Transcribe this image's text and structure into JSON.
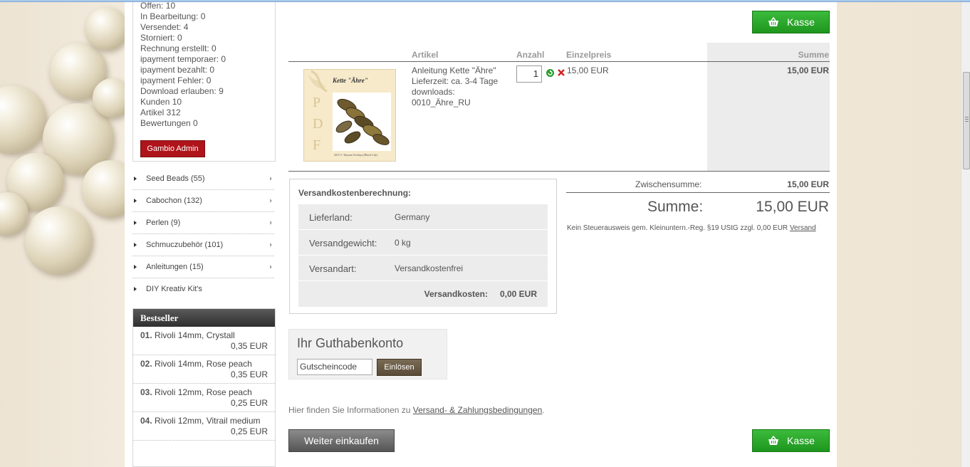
{
  "admin": {
    "stats": [
      "Offen: 10",
      "In Bearbeitung: 0",
      "Versendet: 4",
      "Storniert: 0",
      "Rechnung erstellt: 0",
      "ipayment temporaer: 0",
      "ipayment bezahlt: 0",
      "ipayment Fehler: 0",
      "Download erlauben: 9",
      "Kunden 10",
      "Artikel 312",
      "Bewertungen 0"
    ],
    "button_label": "Gambio Admin"
  },
  "categories": [
    "Seed Beads (55)",
    "Cabochon (132)",
    "Perlen (9)",
    "Schmuczubehör (101)",
    "Anleitungen (15)",
    "DIY Kreativ Kit's"
  ],
  "bestseller": {
    "title": "Bestseller",
    "items": [
      {
        "num": "01.",
        "name": "Rivoli 14mm, Crystall",
        "price": "0,35 EUR"
      },
      {
        "num": "02.",
        "name": "Rivoli 14mm, Rose peach",
        "price": "0,35 EUR"
      },
      {
        "num": "03.",
        "name": "Rivoli 12mm, Rose peach",
        "price": "0,25 EUR"
      },
      {
        "num": "04.",
        "name": "Rivoli 12mm, Vitrail medium",
        "price": "0,25 EUR"
      }
    ]
  },
  "cart": {
    "checkout_label": "Kasse",
    "headers": {
      "article": "Artikel",
      "qty": "Anzahl",
      "unit_price": "Einzelpreis",
      "sum": "Summe"
    },
    "item": {
      "image_title": "Kette \"Ähre\"",
      "image_letters": [
        "P",
        "D",
        "F"
      ],
      "image_caption": "2015 © Tatyana Svetlaya (Black-Lily)",
      "name": "Anleitung Kette \"Ähre\"",
      "delivery": "Lieferzeit: ca. 3-4 Tage",
      "downloads_label": "downloads:",
      "download_file": "0010_Ähre_RU",
      "qty": "1",
      "unit_price": "15,00 EUR",
      "sum": "15,00 EUR"
    },
    "shipping": {
      "title": "Versandkostenberechnung:",
      "rows": [
        {
          "label": "Lieferland:",
          "value": "Germany"
        },
        {
          "label": "Versandgewicht:",
          "value": "0 kg"
        },
        {
          "label": "Versandart:",
          "value": "Versandkostenfrei"
        }
      ],
      "total_label": "Versandkosten:",
      "total_value": "0,00 EUR"
    },
    "subtotal_label": "Zwischensumme:",
    "subtotal_value": "15,00 EUR",
    "total_label": "Summe:",
    "total_value": "15,00 EUR",
    "tax_note": "Kein Steuerausweis gem. Kleinuntern.-Reg. §19 UStG zzgl. 0,00 EUR",
    "tax_link": "Versand",
    "voucher": {
      "title": "Ihr Guthabenkonto",
      "placeholder": "Gutscheincode",
      "button": "Einlösen"
    },
    "info_prefix": "Hier finden Sie Informationen zu",
    "info_link": "Versand- & Zahlungsbedingungen",
    "info_suffix": ".",
    "continue_label": "Weiter einkaufen"
  },
  "colors": {
    "checkout_green": "#2aa82a",
    "admin_red": "#b0141b",
    "voucher_brown": "#6a5b45"
  }
}
